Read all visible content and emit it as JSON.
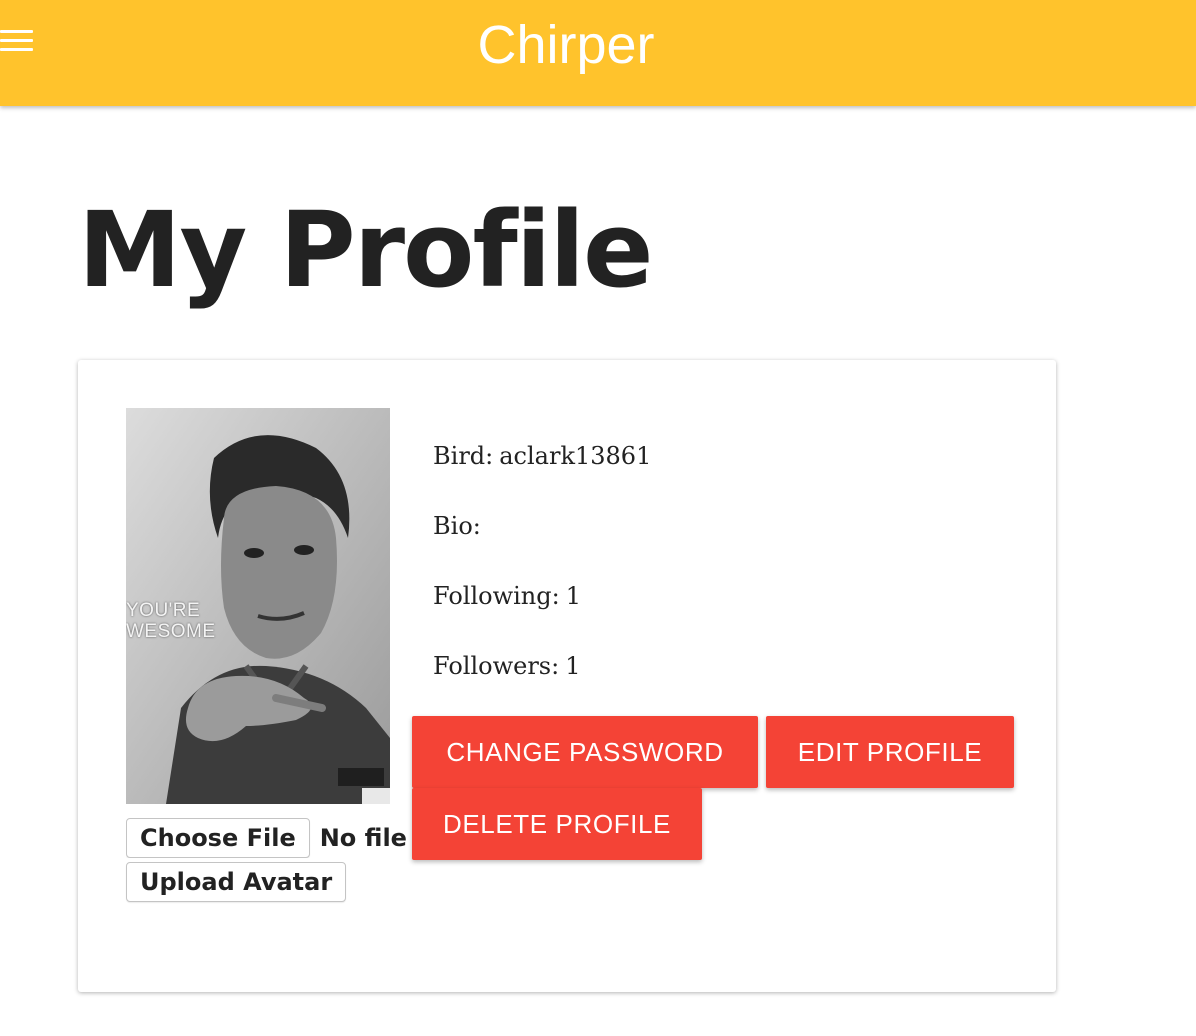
{
  "app": {
    "title": "Chirper"
  },
  "icons": {
    "menu": "hamburger-menu-icon"
  },
  "colors": {
    "app_bar": "#FFC32C",
    "action_button": "#F44336",
    "title_text": "#FFFFFF"
  },
  "page": {
    "title": "My Profile"
  },
  "avatar": {
    "caption_line1": "YOU'RE",
    "caption_line2": "WESOME"
  },
  "file_input": {
    "button_label": "Choose File",
    "status": "No file chosen"
  },
  "upload": {
    "label": "Upload Avatar"
  },
  "profile": {
    "bird_label": "Bird:",
    "bird_value": "aclark13861",
    "bio_label": "Bio:",
    "bio_value": "",
    "following_label": "Following:",
    "following_value": "1",
    "followers_label": "Followers:",
    "followers_value": "1"
  },
  "actions": {
    "change_password": "CHANGE PASSWORD",
    "edit_profile": "EDIT PROFILE",
    "delete_profile": "DELETE PROFILE"
  }
}
